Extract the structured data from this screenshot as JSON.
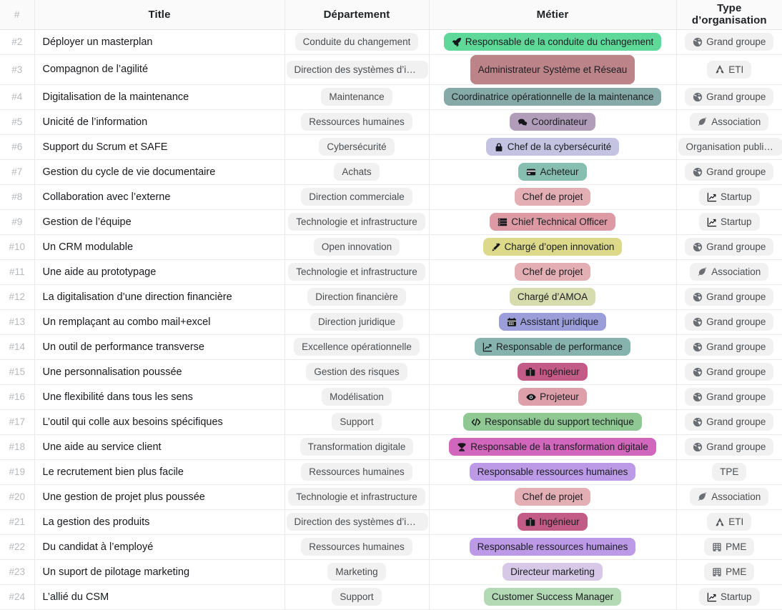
{
  "table": {
    "columns": [
      {
        "key": "num",
        "label": "#"
      },
      {
        "key": "title",
        "label": "Title"
      },
      {
        "key": "dept",
        "label": "Département"
      },
      {
        "key": "job",
        "label": "Métier"
      },
      {
        "key": "org",
        "label": "Type d’organisation"
      }
    ],
    "rows": [
      {
        "num": "#2",
        "title": "Déployer un masterplan",
        "dept": "Conduite du changement",
        "job": "Responsable de la conduite du changement",
        "job_icon": "rocket-icon",
        "job_color": "#5ed99a",
        "org": "Grand groupe",
        "org_icon": "globe-icon"
      },
      {
        "num": "#3",
        "title": "Compagnon de l’agilité",
        "dept": "Direction des systèmes d’infor…",
        "job": "Administrateur Système et Réseau",
        "job_icon": "",
        "job_color": "#bc8489",
        "org": "ETI",
        "org_icon": "bridge-icon",
        "job_overflow": true
      },
      {
        "num": "#4",
        "title": "Digitalisation de la maintenance",
        "dept": "Maintenance",
        "job": "Coordinatrice opérationnelle de la maintenance",
        "job_icon": "",
        "job_color": "#86aaa8",
        "org": "Grand groupe",
        "org_icon": "globe-icon"
      },
      {
        "num": "#5",
        "title": "Unicité de l’information",
        "dept": "Ressources humaines",
        "job": "Coordinateur",
        "job_icon": "speech-icon",
        "job_color": "#b19cba",
        "org": "Association",
        "org_icon": "leaf-icon"
      },
      {
        "num": "#6",
        "title": "Support du Scrum et SAFE",
        "dept": "Cybersécurité",
        "job": "Chef de la cybersécurité",
        "job_icon": "lock-icon",
        "job_color": "#c4c3e2",
        "org": "Organisation publique",
        "org_icon": ""
      },
      {
        "num": "#7",
        "title": "Gestion du cycle de vie documentaire",
        "dept": "Achats",
        "job": "Acheteur",
        "job_icon": "card-icon",
        "job_color": "#86bfb0",
        "org": "Grand groupe",
        "org_icon": "globe-icon"
      },
      {
        "num": "#8",
        "title": "Collaboration avec l’externe",
        "dept": "Direction commerciale",
        "job": "Chef de projet",
        "job_icon": "",
        "job_color": "#e4aeb5",
        "org": "Startup",
        "org_icon": "chart-up-icon"
      },
      {
        "num": "#9",
        "title": "Gestion de l’équipe",
        "dept": "Technologie et infrastructure",
        "job": "Chief Technical Officer",
        "job_icon": "server-icon",
        "job_color": "#dd9aa5",
        "org": "Startup",
        "org_icon": "chart-up-icon"
      },
      {
        "num": "#10",
        "title": "Un CRM modulable",
        "dept": "Open innovation",
        "job": "Chargé d’open innovation",
        "job_icon": "wand-icon",
        "job_color": "#ded municipal",
        "org": "Grand groupe",
        "org_icon": "globe-icon"
      },
      {
        "num": "#11",
        "title": "Une aide au prototypage",
        "dept": "Technologie et infrastructure",
        "job": "Chef de projet",
        "job_icon": "",
        "job_color": "#e4aeb5",
        "org": "Association",
        "org_icon": "leaf-icon"
      },
      {
        "num": "#12",
        "title": "La digitalisation d’une direction financière",
        "dept": "Direction financière",
        "job": "Chargé d’AMOA",
        "job_icon": "",
        "job_color": "#d6dcae",
        "org": "Grand groupe",
        "org_icon": "globe-icon"
      },
      {
        "num": "#13",
        "title": "Un remplaçant au combo mail+excel",
        "dept": "Direction juridique",
        "job": "Assistant juridique",
        "job_icon": "calendar-icon",
        "job_color": "#9b9ed8",
        "org": "Grand groupe",
        "org_icon": "globe-icon"
      },
      {
        "num": "#14",
        "title": "Un outil de performance transverse",
        "dept": "Excellence opérationnelle",
        "job": "Responsable de performance",
        "job_icon": "chart-up-icon",
        "job_color": "#86b3ad",
        "org": "Grand groupe",
        "org_icon": "globe-icon"
      },
      {
        "num": "#15",
        "title": "Une personnalisation poussée",
        "dept": "Gestion des risques",
        "job": "Ingénieur",
        "job_icon": "briefcase-icon",
        "job_color": "#c25b85",
        "org": "Grand groupe",
        "org_icon": "globe-icon"
      },
      {
        "num": "#16",
        "title": "Une flexibilité dans tous les sens",
        "dept": "Modélisation",
        "job": "Projeteur",
        "job_icon": "eye-icon",
        "job_color": "#dda0ab",
        "org": "Grand groupe",
        "org_icon": "globe-icon"
      },
      {
        "num": "#17",
        "title": "L’outil qui colle aux besoins spécifiques",
        "dept": "Support",
        "job": "Responsable du support technique",
        "job_icon": "code-icon",
        "job_color": "#8fc893",
        "org": "Grand groupe",
        "org_icon": "globe-icon"
      },
      {
        "num": "#18",
        "title": "Une aide au service client",
        "dept": "Transformation digitale",
        "job": "Responsable de la transformation digitale",
        "job_icon": "trophy-icon",
        "job_color": "#d167bc",
        "org": "Grand groupe",
        "org_icon": "globe-icon"
      },
      {
        "num": "#19",
        "title": "Le recrutement bien plus facile",
        "dept": "Ressources humaines",
        "job": "Responsable ressources humaines",
        "job_icon": "",
        "job_color": "#bd9ae8",
        "org": "TPE",
        "org_icon": ""
      },
      {
        "num": "#20",
        "title": "Une gestion de projet plus poussée",
        "dept": "Technologie et infrastructure",
        "job": "Chef de projet",
        "job_icon": "",
        "job_color": "#e4aeb5",
        "org": "Association",
        "org_icon": "leaf-icon"
      },
      {
        "num": "#21",
        "title": "La gestion des produits",
        "dept": "Direction des systèmes d’infor…",
        "job": "Ingénieur",
        "job_icon": "briefcase-icon",
        "job_color": "#c25b85",
        "org": "ETI",
        "org_icon": "bridge-icon"
      },
      {
        "num": "#22",
        "title": "Du candidat à l’employé",
        "dept": "Ressources humaines",
        "job": "Responsable ressources humaines",
        "job_icon": "",
        "job_color": "#bd9ae8",
        "org": "PME",
        "org_icon": "building-icon"
      },
      {
        "num": "#23",
        "title": "Un suport de pilotage marketing",
        "dept": "Marketing",
        "job": "Directeur marketing",
        "job_icon": "",
        "job_color": "#d7c8e8",
        "org": "PME",
        "org_icon": "building-icon"
      },
      {
        "num": "#24",
        "title": "L’allié du CSM",
        "dept": "Support",
        "job": "Customer Success Manager",
        "job_icon": "",
        "job_color": "#b3d9b5",
        "org": "Startup",
        "org_icon": "chart-up-icon"
      }
    ]
  },
  "colors": {
    "pill_neutral_bg": "#f1f1f1",
    "pill_neutral_text": "#4a4d50",
    "header_bg": "#fafafa",
    "border": "#e9eaeb",
    "num_text": "#b6b9bc"
  }
}
